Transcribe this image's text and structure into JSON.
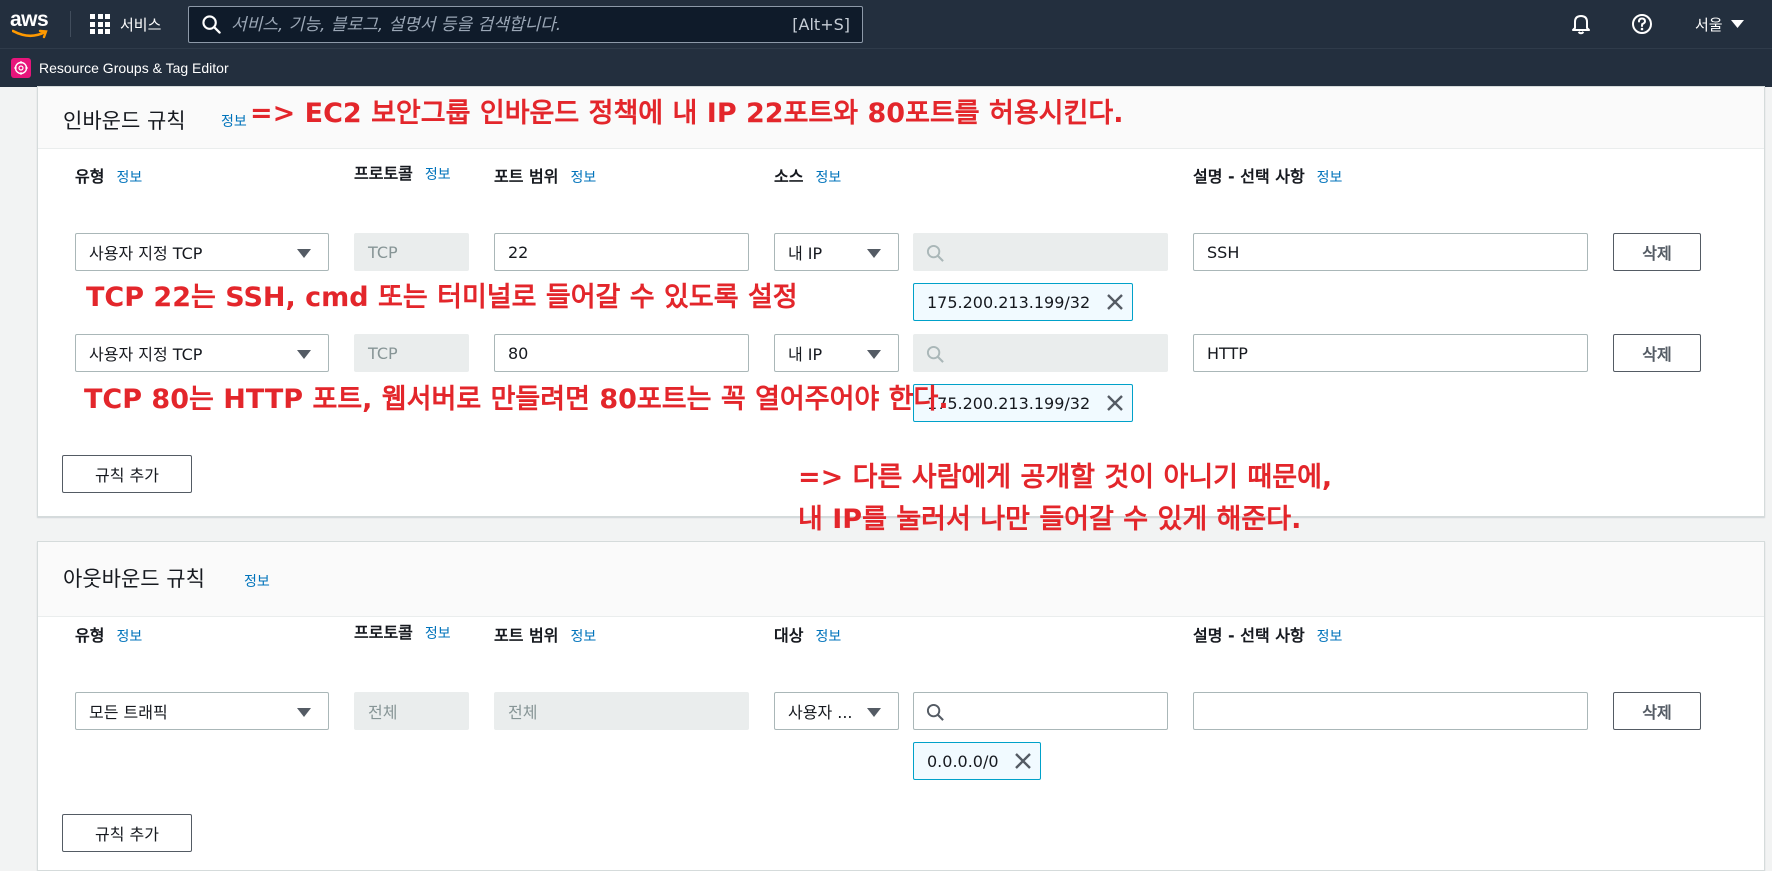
{
  "nav": {
    "logo_text": "aws",
    "services_label": "서비스",
    "search_placeholder": "서비스, 기능, 블로그, 설명서 등을 검색합니다.",
    "search_shortcut": "[Alt+S]",
    "region_label": "서울"
  },
  "subbar": {
    "label": "Resource Groups & Tag Editor"
  },
  "inbound": {
    "title": "인바운드 규칙",
    "info": "정보",
    "columns": {
      "type": "유형",
      "protocol": "프로토콜",
      "port_range": "포트 범위",
      "source": "소스",
      "description": "설명 - 선택 사항",
      "info": "정보"
    },
    "rows": [
      {
        "type": "사용자 지정 TCP",
        "protocol": "TCP",
        "port": "22",
        "source_type": "내 IP",
        "cidr": "175.200.213.199/32",
        "description": "SSH",
        "delete": "삭제"
      },
      {
        "type": "사용자 지정 TCP",
        "protocol": "TCP",
        "port": "80",
        "source_type": "내 IP",
        "cidr": "175.200.213.199/32",
        "description": "HTTP",
        "delete": "삭제"
      }
    ],
    "add_rule": "규칙 추가"
  },
  "outbound": {
    "title": "아웃바운드 규칙",
    "info": "정보",
    "columns": {
      "type": "유형",
      "protocol": "프로토콜",
      "port_range": "포트 범위",
      "destination": "대상",
      "description": "설명 - 선택 사항",
      "info": "정보"
    },
    "rows": [
      {
        "type": "모든 트래픽",
        "protocol": "전체",
        "port": "전체",
        "destination_type": "사용자 ...",
        "cidr": "0.0.0.0/0",
        "description": "",
        "delete": "삭제"
      }
    ],
    "add_rule": "규칙 추가"
  },
  "annotations": {
    "a1": "=> EC2 보안그룹 인바운드 정책에 내 IP 22포트와 80포트를 허용시킨다.",
    "a2": "TCP 22는 SSH, cmd 또는 터미널로 들어갈 수 있도록 설정",
    "a3": "TCP 80는 HTTP 포트, 웹서버로 만들려면 80포트는 꼭 열어주어야 한다.",
    "a4": "=> 다른 사람에게 공개할 것이 아니기 때문에,",
    "a5": "내 IP를 눌러서 나만 들어갈 수 있게 해준다."
  },
  "colors": {
    "nav_bg": "#232f3e",
    "link": "#0073bb",
    "annotation": "#e3262b",
    "token_border": "#00a1c9"
  }
}
